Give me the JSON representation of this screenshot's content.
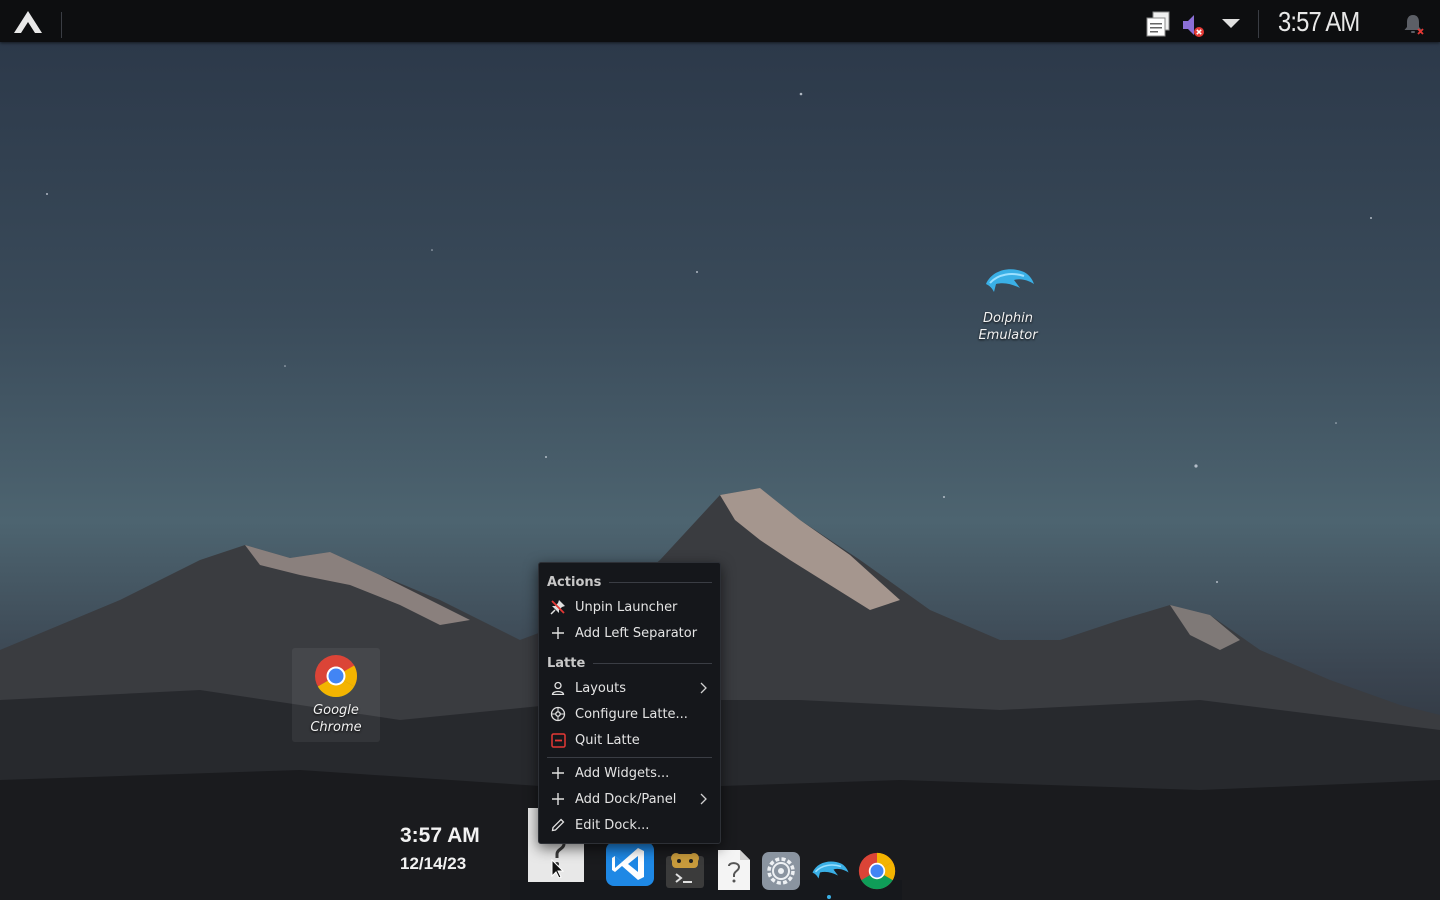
{
  "top_panel": {
    "launcher_icon": "arch-linux-logo-icon",
    "tray": {
      "clipboard_icon": "clipboard-icon",
      "volume_icon": "volume-muted-icon",
      "expand_icon": "tray-expand-icon"
    },
    "clock": "3:57 AM",
    "notifications_icon": "notifications-disabled-icon"
  },
  "desktop": {
    "icons": [
      {
        "label_line1": "Dolphin",
        "label_line2": "Emulator",
        "icon": "dolphin-emulator-icon"
      },
      {
        "label_line1": "Google",
        "label_line2": "Chrome",
        "icon": "google-chrome-icon"
      }
    ],
    "clock_widget": {
      "time": "3:57 AM",
      "date": "12/14/23"
    }
  },
  "context_menu": {
    "sections": {
      "actions": "Actions",
      "latte": "Latte"
    },
    "items": {
      "unpin_launcher": "Unpin Launcher",
      "add_left_separator": "Add Left Separator",
      "layouts": "Layouts",
      "configure_latte": "Configure Latte...",
      "quit_latte": "Quit Latte",
      "add_widgets": "Add Widgets...",
      "add_dock_panel": "Add Dock/Panel",
      "edit_dock": "Edit Dock..."
    }
  },
  "dock": {
    "items": [
      {
        "icon": "unknown-file-icon",
        "state": "hovered"
      },
      {
        "icon": "vscode-icon"
      },
      {
        "icon": "terminal-icon"
      },
      {
        "icon": "unknown-file-icon"
      },
      {
        "icon": "settings-icon"
      },
      {
        "icon": "dolphin-emulator-icon",
        "state": "running"
      },
      {
        "icon": "google-chrome-icon"
      }
    ]
  },
  "colors": {
    "panel_bg": "#0d0e10",
    "menu_bg": "#15171b",
    "accent_red": "#e53935",
    "vscode_blue": "#1e88e5",
    "dolphin_blue": "#3ab0e6"
  }
}
